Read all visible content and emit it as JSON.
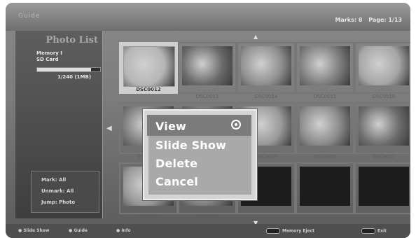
{
  "header": {
    "brand": "Guide",
    "marks": "Marks: 8",
    "page": "Page: 1/13"
  },
  "sidebar": {
    "title": "Photo List",
    "memory_name": "Memory I",
    "memory_type": "SD Card",
    "memory_count": "1/240 (1MB)",
    "memory_fill_fraction": 0.85,
    "summary": [
      "Mark: All",
      "Unmark: All",
      "Jump: Photo"
    ]
  },
  "thumbnails": [
    {
      "caption": "DSC0012",
      "selected": true,
      "tone": "#b5b5b5"
    },
    {
      "caption": "DSC0013",
      "selected": false,
      "tone": "#6a6a6a"
    },
    {
      "caption": "DSC0014",
      "selected": false,
      "tone": "#8f8f8f"
    },
    {
      "caption": "DSC0015",
      "selected": false,
      "tone": "#7d7d7d"
    },
    {
      "caption": "DSC0016",
      "selected": false,
      "tone": "#a5a5a5"
    },
    {
      "caption": "DSC0017",
      "selected": false,
      "tone": "#7a7a7a"
    },
    {
      "caption": "DSC0018",
      "selected": false,
      "tone": "#707070"
    },
    {
      "caption": "DSC0019",
      "selected": false,
      "tone": "#999999"
    },
    {
      "caption": "DSC0020",
      "selected": false,
      "tone": "#8a8a8a"
    },
    {
      "caption": "DSC0021",
      "selected": false,
      "tone": "#6d6d6d"
    },
    {
      "caption": "DSC0022",
      "selected": false,
      "tone": "#969696"
    },
    {
      "caption": "DSC0023",
      "selected": false,
      "tone": "#7f7f7f"
    },
    {
      "caption": "",
      "selected": false,
      "tone": "#1c1c1c"
    },
    {
      "caption": "",
      "selected": false,
      "tone": "#1c1c1c"
    },
    {
      "caption": "",
      "selected": false,
      "tone": "#1c1c1c"
    }
  ],
  "context_menu": {
    "items": [
      "View",
      "Slide Show",
      "Delete",
      "Cancel"
    ],
    "selected_index": 0
  },
  "footer": {
    "hints": [
      "Slide Show",
      "Guide",
      "Info"
    ],
    "memory_hint": "Memory Eject",
    "exit_hint": "Exit"
  },
  "colors": {
    "menu_text": "#ffffff",
    "menu_bg": "#a9a9a9",
    "menu_highlight": "#7b7b7b"
  }
}
